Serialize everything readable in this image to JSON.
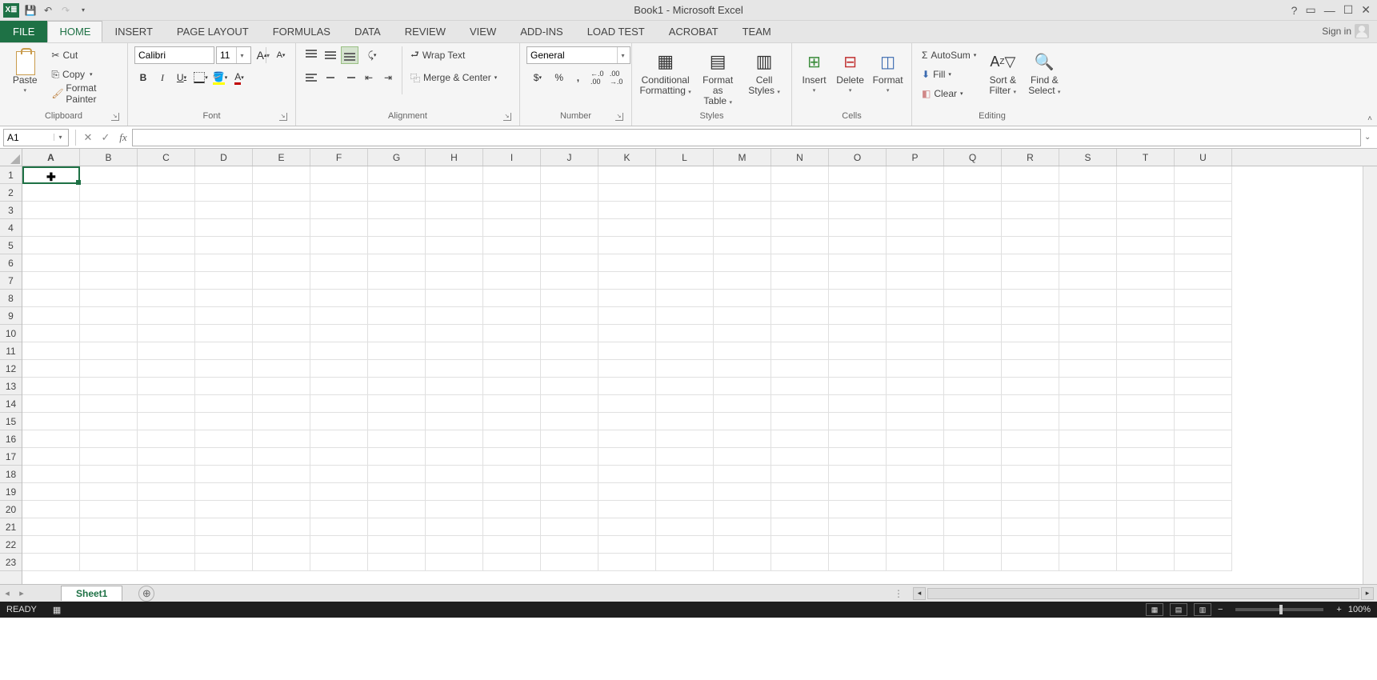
{
  "titlebar": {
    "title": "Book1 - Microsoft Excel",
    "logo_text": "X≣"
  },
  "tabs": {
    "file": "FILE",
    "items": [
      "HOME",
      "INSERT",
      "PAGE LAYOUT",
      "FORMULAS",
      "DATA",
      "REVIEW",
      "VIEW",
      "ADD-INS",
      "LOAD TEST",
      "ACROBAT",
      "TEAM"
    ],
    "active": "HOME",
    "signin": "Sign in"
  },
  "ribbon": {
    "clipboard": {
      "paste": "Paste",
      "cut": "Cut",
      "copy": "Copy",
      "format_painter": "Format Painter",
      "label": "Clipboard"
    },
    "font": {
      "name": "Calibri",
      "size": "11",
      "bold": "B",
      "italic": "I",
      "underline": "U",
      "label": "Font"
    },
    "alignment": {
      "wrap": "Wrap Text",
      "merge": "Merge & Center",
      "label": "Alignment"
    },
    "number": {
      "format": "General",
      "label": "Number"
    },
    "styles": {
      "cond": "Conditional",
      "cond2": "Formatting",
      "fmt_tbl": "Format as",
      "fmt_tbl2": "Table",
      "cell": "Cell",
      "cell2": "Styles",
      "label": "Styles"
    },
    "cells": {
      "insert": "Insert",
      "delete": "Delete",
      "format": "Format",
      "label": "Cells"
    },
    "editing": {
      "autosum": "AutoSum",
      "fill": "Fill",
      "clear": "Clear",
      "sort": "Sort &",
      "sort2": "Filter",
      "find": "Find &",
      "find2": "Select",
      "label": "Editing"
    }
  },
  "formula_bar": {
    "namebox": "A1",
    "formula": ""
  },
  "grid": {
    "columns": [
      "A",
      "B",
      "C",
      "D",
      "E",
      "F",
      "G",
      "H",
      "I",
      "J",
      "K",
      "L",
      "M",
      "N",
      "O",
      "P",
      "Q",
      "R",
      "S",
      "T",
      "U"
    ],
    "rows": [
      1,
      2,
      3,
      4,
      5,
      6,
      7,
      8,
      9,
      10,
      11,
      12,
      13,
      14,
      15,
      16,
      17,
      18,
      19,
      20,
      21,
      22,
      23
    ]
  },
  "sheets": {
    "active": "Sheet1"
  },
  "status": {
    "ready": "READY",
    "zoom": "100%"
  }
}
